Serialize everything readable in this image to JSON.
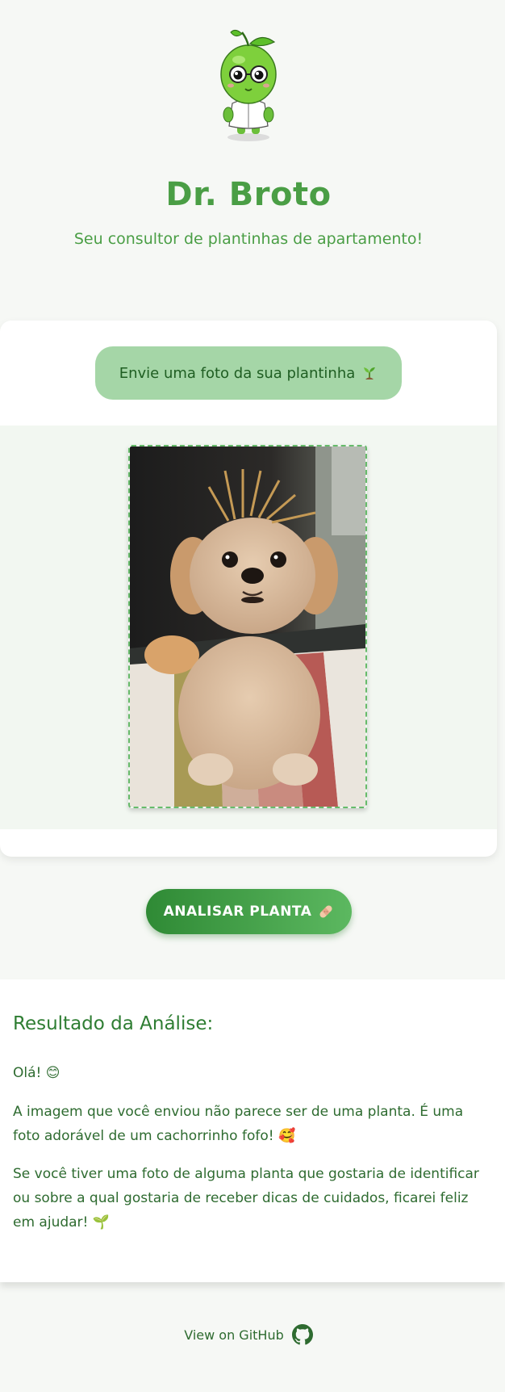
{
  "header": {
    "title": "Dr. Broto",
    "subtitle": "Seu consultor de plantinhas de apartamento!"
  },
  "upload": {
    "button_label": "Envie uma foto da sua plantinha",
    "button_icon": "seedling-icon"
  },
  "preview": {
    "image_description": "photo"
  },
  "analyze": {
    "button_label": "ANALISAR PLANTA",
    "button_icon": "bandage-icon"
  },
  "result": {
    "title": "Resultado da Análise:",
    "paragraph_1": "Olá! 😊",
    "paragraph_2": "A imagem que você enviou não parece ser de uma planta. É uma foto adorável de um cachorrinho fofo! 🥰",
    "paragraph_3": "Se você tiver uma foto de alguma planta que gostaria de identificar ou sobre a qual gostaria de receber dicas de cuidados, ficarei feliz em ajudar! 🌱"
  },
  "footer": {
    "link_label": "View on GitHub",
    "link_icon": "github-icon"
  },
  "colors": {
    "brand_green": "#4a9e45",
    "button_light_green": "#a5d6a7",
    "button_dark_green": "#2f8a35",
    "background": "#f6f8f5"
  }
}
